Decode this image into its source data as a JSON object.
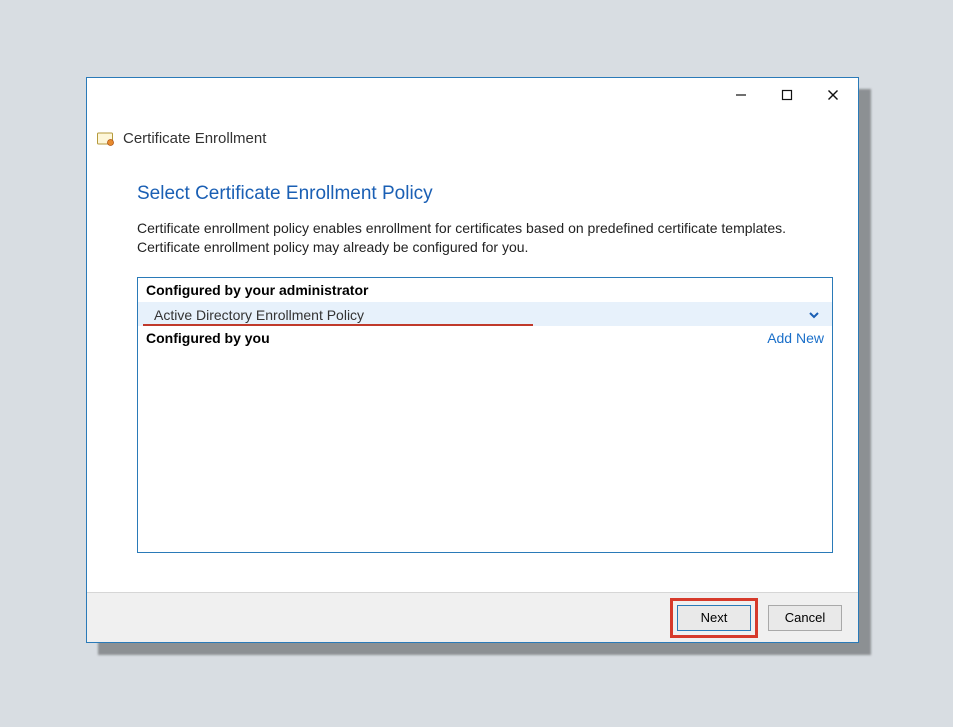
{
  "window": {
    "title": "Certificate Enrollment"
  },
  "page": {
    "heading": "Select Certificate Enrollment Policy",
    "description": "Certificate enrollment policy enables enrollment for certificates based on predefined certificate templates. Certificate enrollment policy may already be configured for you."
  },
  "policy_box": {
    "admin_section_label": "Configured by your administrator",
    "admin_policy_name": "Active Directory Enrollment Policy",
    "user_section_label": "Configured by you",
    "add_new_label": "Add New"
  },
  "buttons": {
    "next": "Next",
    "cancel": "Cancel"
  },
  "colors": {
    "accent": "#1a5fb4",
    "highlight_red": "#d63a2b",
    "border_blue": "#2a7ab8"
  }
}
